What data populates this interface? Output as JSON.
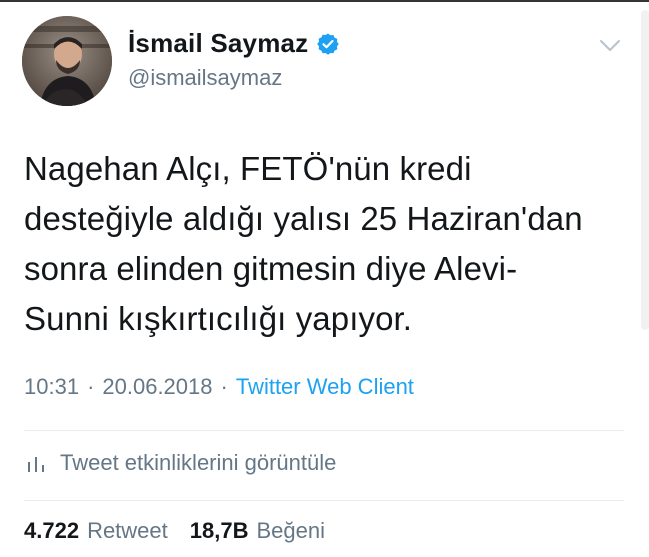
{
  "user": {
    "display_name": "İsmail Saymaz",
    "handle": "@ismailsaymaz",
    "verified": true
  },
  "icons": {
    "verified_badge": "verified-badge-icon",
    "caret": "chevron-down-icon",
    "activity": "bar-chart-icon",
    "avatar": "avatar-photo"
  },
  "tweet": {
    "lines": [
      "Nagehan Alçı, FETÖ'nün kredi",
      "desteğiyle aldığı yalısı 25 Haziran'dan",
      "sonra elinden gitmesin diye Alevi-",
      "Sunni kışkırtıcılığı yapıyor."
    ],
    "time": "10:31",
    "sep1": "·",
    "date": "20.06.2018",
    "sep2": "·",
    "client": "Twitter Web Client"
  },
  "activity": {
    "label": "Tweet etkinliklerini görüntüle"
  },
  "stats": {
    "retweets_value": "4.722",
    "retweets_label": "Retweet",
    "likes_value": "18,7B",
    "likes_label": "Beğeni"
  },
  "colors": {
    "text": "#14171a",
    "secondary": "#657786",
    "link": "#1da1f2",
    "divider": "#e6ecf0",
    "verified": "#1da1f2"
  }
}
